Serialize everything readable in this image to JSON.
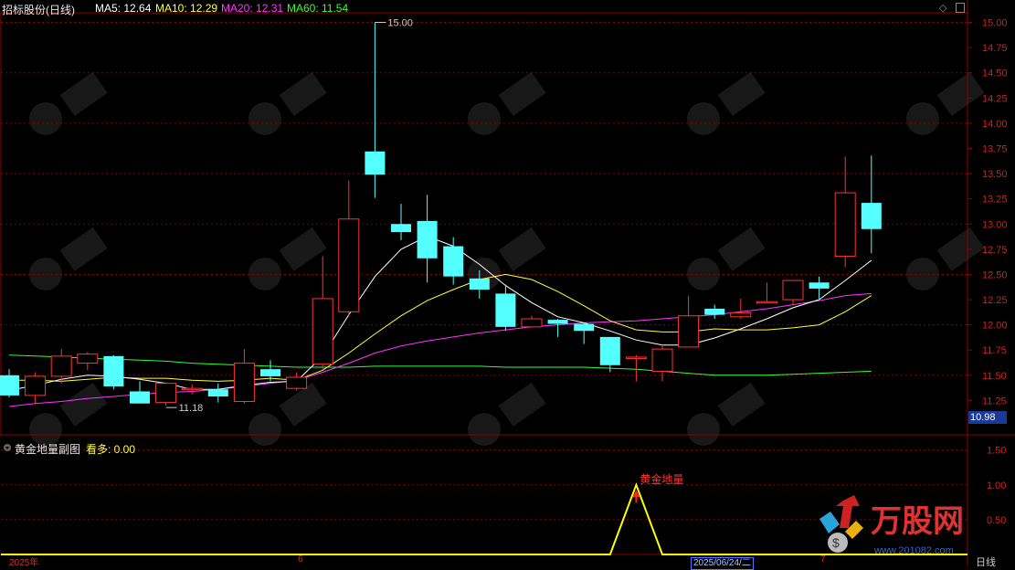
{
  "header": {
    "title": "招标股份(日线)",
    "ma5": "MA5: 12.64",
    "ma10": "MA10: 12.29",
    "ma20": "MA20: 12.31",
    "ma60": "MA60: 11.54"
  },
  "subchart": {
    "title": "黄金地量副图",
    "value": "看多: 0.00",
    "signal_label": "黄金地量"
  },
  "price_tag": "10.98",
  "date_tag": "2025/06/24/二",
  "x_labels": [
    "2025年",
    "6",
    "7"
  ],
  "period_label": "日线",
  "logo_text": "万股网",
  "logo_url": "www.201082.com",
  "colors": {
    "up": "#ff3333",
    "down": "#54ffff",
    "ma5": "#ffffff",
    "ma10": "#ffff33",
    "ma20": "#ff33ff",
    "ma60": "#33ff33",
    "grid": "#8b0000",
    "signal": "#ffff00"
  },
  "chart_data": [
    {
      "type": "candlestick",
      "y_range": [
        11.0,
        15.05
      ],
      "y_ticks": [
        11.25,
        11.5,
        11.75,
        12.0,
        12.25,
        12.5,
        12.75,
        13.0,
        13.25,
        13.5,
        13.75,
        14.0,
        14.25,
        14.5,
        14.75,
        15.0
      ],
      "annotations": [
        {
          "label": "15.00",
          "value": 15.0
        },
        {
          "label": "11.18",
          "value": 11.18
        }
      ],
      "candles": [
        {
          "o": 11.5,
          "h": 11.56,
          "l": 11.28,
          "c": 11.3
        },
        {
          "o": 11.3,
          "h": 11.53,
          "l": 11.22,
          "c": 11.49
        },
        {
          "o": 11.49,
          "h": 11.76,
          "l": 11.42,
          "c": 11.69
        },
        {
          "o": 11.62,
          "h": 11.73,
          "l": 11.55,
          "c": 11.71
        },
        {
          "o": 11.69,
          "h": 11.7,
          "l": 11.36,
          "c": 11.39
        },
        {
          "o": 11.34,
          "h": 11.44,
          "l": 11.23,
          "c": 11.22
        },
        {
          "o": 11.23,
          "h": 11.43,
          "l": 11.2,
          "c": 11.42
        },
        {
          "o": 11.36,
          "h": 11.41,
          "l": 11.31,
          "c": 11.37
        },
        {
          "o": 11.36,
          "h": 11.42,
          "l": 11.23,
          "c": 11.29
        },
        {
          "o": 11.24,
          "h": 11.76,
          "l": 11.22,
          "c": 11.62
        },
        {
          "o": 11.56,
          "h": 11.65,
          "l": 11.44,
          "c": 11.49
        },
        {
          "o": 11.37,
          "h": 11.53,
          "l": 11.35,
          "c": 11.48
        },
        {
          "o": 11.61,
          "h": 12.68,
          "l": 11.55,
          "c": 12.26
        },
        {
          "o": 12.13,
          "h": 13.43,
          "l": 12.08,
          "c": 13.05
        },
        {
          "o": 13.72,
          "h": 15.0,
          "l": 13.26,
          "c": 13.49
        },
        {
          "o": 13.0,
          "h": 13.2,
          "l": 12.84,
          "c": 12.92
        },
        {
          "o": 13.03,
          "h": 13.29,
          "l": 12.42,
          "c": 12.66
        },
        {
          "o": 12.78,
          "h": 12.87,
          "l": 12.4,
          "c": 12.48
        },
        {
          "o": 12.46,
          "h": 12.54,
          "l": 12.26,
          "c": 12.35
        },
        {
          "o": 12.31,
          "h": 12.4,
          "l": 11.94,
          "c": 11.98
        },
        {
          "o": 11.98,
          "h": 12.09,
          "l": 11.98,
          "c": 12.06
        },
        {
          "o": 12.05,
          "h": 12.06,
          "l": 11.88,
          "c": 12.01
        },
        {
          "o": 12.01,
          "h": 12.02,
          "l": 11.81,
          "c": 11.94
        },
        {
          "o": 11.88,
          "h": 11.88,
          "l": 11.53,
          "c": 11.6
        },
        {
          "o": 11.67,
          "h": 11.7,
          "l": 11.44,
          "c": 11.68
        },
        {
          "o": 11.54,
          "h": 11.81,
          "l": 11.44,
          "c": 11.76
        },
        {
          "o": 11.78,
          "h": 12.29,
          "l": 11.78,
          "c": 12.09
        },
        {
          "o": 12.16,
          "h": 12.2,
          "l": 12.06,
          "c": 12.1
        },
        {
          "o": 12.08,
          "h": 12.26,
          "l": 12.06,
          "c": 12.12
        },
        {
          "o": 12.22,
          "h": 12.42,
          "l": 12.22,
          "c": 12.23
        },
        {
          "o": 12.25,
          "h": 12.44,
          "l": 12.2,
          "c": 12.44
        },
        {
          "o": 12.42,
          "h": 12.48,
          "l": 12.26,
          "c": 12.36
        },
        {
          "o": 12.68,
          "h": 13.67,
          "l": 12.57,
          "c": 13.31
        },
        {
          "o": 13.21,
          "h": 13.68,
          "l": 12.71,
          "c": 12.95
        }
      ],
      "ma5": [
        11.35,
        11.4,
        11.46,
        11.5,
        11.49,
        11.46,
        11.42,
        11.36,
        11.36,
        11.4,
        11.43,
        11.44,
        11.69,
        12.1,
        12.48,
        12.75,
        12.88,
        12.78,
        12.6,
        12.39,
        12.22,
        12.08,
        12.02,
        11.94,
        11.85,
        11.8,
        11.8,
        11.87,
        11.96,
        12.06,
        12.17,
        12.25,
        12.44,
        12.64
      ],
      "ma10": [
        11.45,
        11.45,
        11.44,
        11.46,
        11.48,
        11.47,
        11.47,
        11.45,
        11.44,
        11.45,
        11.47,
        11.45,
        11.55,
        11.72,
        11.91,
        12.09,
        12.24,
        12.35,
        12.45,
        12.5,
        12.45,
        12.33,
        12.19,
        12.04,
        11.95,
        11.93,
        11.93,
        11.96,
        11.95,
        11.95,
        11.97,
        12.0,
        12.13,
        12.29
      ],
      "ma20": [
        11.19,
        11.22,
        11.24,
        11.27,
        11.29,
        11.31,
        11.33,
        11.34,
        11.36,
        11.39,
        11.42,
        11.45,
        11.53,
        11.62,
        11.72,
        11.79,
        11.84,
        11.88,
        11.92,
        11.95,
        11.98,
        12.0,
        12.02,
        12.03,
        12.04,
        12.06,
        12.08,
        12.1,
        12.13,
        12.16,
        12.2,
        12.24,
        12.29,
        12.31
      ],
      "ma60": [
        11.7,
        11.69,
        11.68,
        11.67,
        11.66,
        11.65,
        11.64,
        11.62,
        11.61,
        11.6,
        11.59,
        11.58,
        11.58,
        11.58,
        11.59,
        11.59,
        11.59,
        11.59,
        11.59,
        11.58,
        11.58,
        11.58,
        11.58,
        11.57,
        11.56,
        11.54,
        11.52,
        11.5,
        11.5,
        11.5,
        11.51,
        11.52,
        11.53,
        11.54
      ]
    },
    {
      "type": "line",
      "series": [
        {
          "values": [
            0,
            0,
            0,
            0,
            0,
            0,
            0,
            0,
            0,
            0,
            0,
            0,
            0,
            0,
            0,
            0,
            0,
            0,
            0,
            0,
            0,
            0,
            0,
            0,
            1,
            0,
            0,
            0,
            0,
            0,
            0,
            0,
            0,
            0
          ]
        }
      ],
      "y_range": [
        0,
        1.6
      ],
      "y_ticks": [
        0.5,
        1.0,
        1.5
      ]
    }
  ]
}
